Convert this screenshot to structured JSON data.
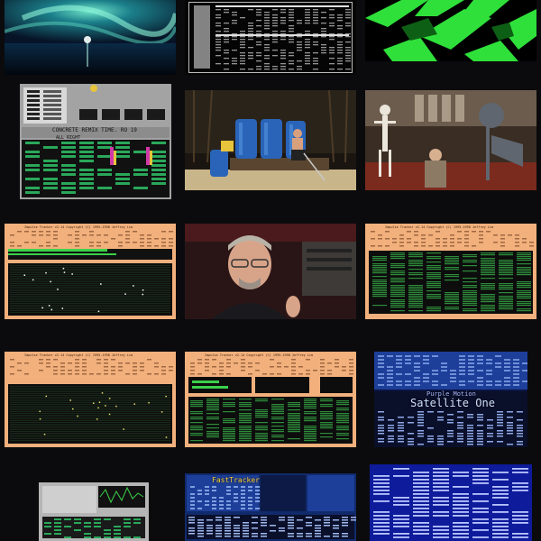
{
  "gallery": {
    "tiles": [
      {
        "id": "r1c1",
        "kind": "photo",
        "subject": "aurora-night-sky"
      },
      {
        "id": "r1c2",
        "kind": "screenshot",
        "subject": "tracker-pattern-grid-monochrome"
      },
      {
        "id": "r1c3",
        "kind": "screenshot",
        "subject": "green-checkerboard-tunnel"
      },
      {
        "id": "r2c1",
        "kind": "screenshot",
        "subject": "grey-tracker-ui",
        "title_text": "CONCRETE REMIX TIME. RO 19",
        "status_text": "ALL RIGHT"
      },
      {
        "id": "r2c2",
        "kind": "photo",
        "subject": "drummer-on-blue-barrels"
      },
      {
        "id": "r2c3",
        "kind": "photo",
        "subject": "man-with-skeleton-and-gramophone"
      },
      {
        "id": "r3c1",
        "kind": "screenshot",
        "subject": "impulse-tracker-orange",
        "header_text": "Impulse Tracker v2.14 Copyright (C) 1995-1998 Jeffrey Lim"
      },
      {
        "id": "r3c2",
        "kind": "photo",
        "subject": "interview-man-with-glasses"
      },
      {
        "id": "r3c3",
        "kind": "screenshot",
        "subject": "impulse-tracker-orange-patterns",
        "header_text": "Impulse Tracker v2.14 Copyright (C) 1995-1998 Jeffrey Lim"
      },
      {
        "id": "r4c1",
        "kind": "screenshot",
        "subject": "impulse-tracker-orange-dots",
        "header_text": "Impulse Tracker v2.14 Copyright (C) 1995-1998 Jeffrey Lim"
      },
      {
        "id": "r4c2",
        "kind": "screenshot",
        "subject": "impulse-tracker-orange-dense",
        "header_text": "Impulse Tracker v2.14 Copyright (C) 1995-1998 Jeffrey Lim"
      },
      {
        "id": "r4c3",
        "kind": "screenshot",
        "subject": "fasttracker-blue",
        "artist_text": "Purple Motion",
        "song_text": "Satellite One"
      },
      {
        "id": "r5c1",
        "kind": "screenshot",
        "subject": "grey-tracker-small"
      },
      {
        "id": "r5c2",
        "kind": "screenshot",
        "subject": "fasttracker-2-blue",
        "logo_text": "FastTracker"
      },
      {
        "id": "r5c3",
        "kind": "screenshot",
        "subject": "blue-tracker-columns"
      }
    ]
  },
  "colors": {
    "background": "#0b0b0d",
    "impulse_bg": "#f2b07c",
    "tracker_green": "#33d14a",
    "ft_blue": "#1d3f9a"
  }
}
